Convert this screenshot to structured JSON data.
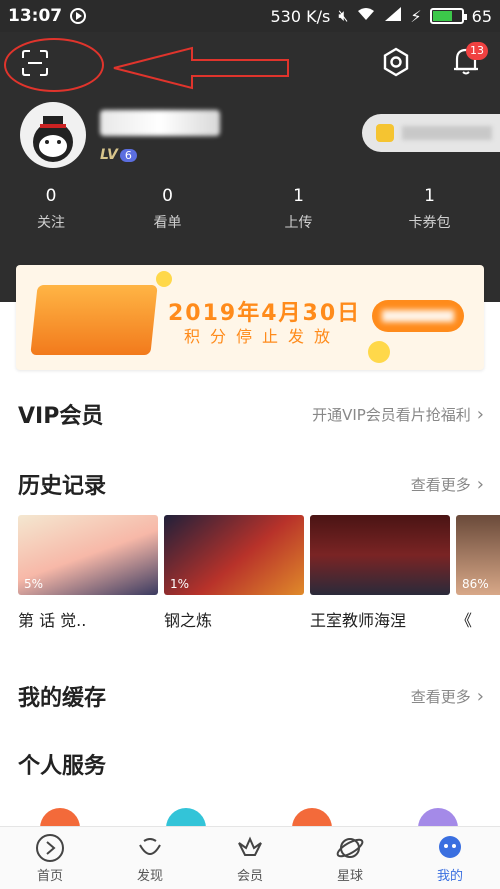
{
  "status_bar": {
    "time": "13:07",
    "speed": "530 K/s",
    "battery": "65"
  },
  "header": {
    "notification_count": "13",
    "level_prefix": "LV",
    "level": "6"
  },
  "stats": [
    {
      "value": "0",
      "label": "关注"
    },
    {
      "value": "0",
      "label": "看单"
    },
    {
      "value": "1",
      "label": "上传"
    },
    {
      "value": "1",
      "label": "卡券包"
    }
  ],
  "banner": {
    "title": "2019年4月30日",
    "subtitle": "积分停止发放"
  },
  "vip_section": {
    "title": "VIP会员",
    "link": "开通VIP会员看片抢福利"
  },
  "history_section": {
    "title": "历史记录",
    "more": "查看更多",
    "items": [
      {
        "title": "第 话 觉..",
        "progress": "5%"
      },
      {
        "title": "钢之炼",
        "progress": "1%"
      },
      {
        "title": "王室教师海涅",
        "progress": ""
      },
      {
        "title": "《",
        "progress": "86%"
      }
    ]
  },
  "cache_section": {
    "title": "我的缓存",
    "more": "查看更多"
  },
  "service_section": {
    "title": "个人服务"
  },
  "bottom_nav": [
    {
      "label": "首页",
      "icon": "home-icon"
    },
    {
      "label": "发现",
      "icon": "discover-icon"
    },
    {
      "label": "会员",
      "icon": "vip-icon"
    },
    {
      "label": "星球",
      "icon": "planet-icon"
    },
    {
      "label": "我的",
      "icon": "profile-icon",
      "active": true
    }
  ],
  "colors": {
    "accent": "#ff8b1b",
    "header_bg": "#2e2e2e",
    "annotation": "#e0342c",
    "nav_active": "#3a6fe0"
  }
}
